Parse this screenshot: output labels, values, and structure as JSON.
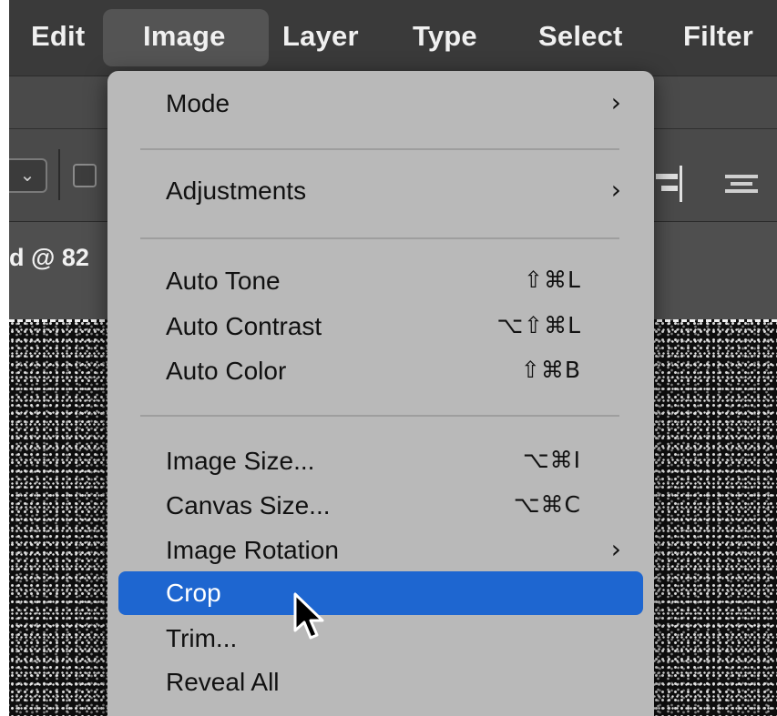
{
  "menubar": {
    "items": [
      "Edit",
      "Image",
      "Layer",
      "Type",
      "Select",
      "Filter"
    ],
    "active": "Image"
  },
  "document": {
    "tab_title_fragment": "d @ 82"
  },
  "image_menu": {
    "mode": {
      "label": "Mode",
      "submenu": true
    },
    "adjustments": {
      "label": "Adjustments",
      "submenu": true
    },
    "auto_tone": {
      "label": "Auto Tone",
      "shortcut": "⇧⌘L"
    },
    "auto_contrast": {
      "label": "Auto Contrast",
      "shortcut": "⌥⇧⌘L"
    },
    "auto_color": {
      "label": "Auto Color",
      "shortcut": "⇧⌘B"
    },
    "image_size": {
      "label": "Image Size...",
      "shortcut": "⌥⌘I"
    },
    "canvas_size": {
      "label": "Canvas Size...",
      "shortcut": "⌥⌘C"
    },
    "image_rotation": {
      "label": "Image Rotation",
      "submenu": true
    },
    "crop": {
      "label": "Crop",
      "selected": true
    },
    "trim": {
      "label": "Trim..."
    },
    "reveal_all": {
      "label": "Reveal All"
    },
    "submenu_glyph": "›"
  },
  "icons": {
    "dropdown": "chevron-down-icon",
    "checkbox": "checkbox-icon",
    "align_right": "align-right-icon",
    "align_center": "align-center-icon",
    "cursor": "arrow-cursor-icon"
  },
  "colors": {
    "menu_bg": "#b9b9b9",
    "selection": "#1e66d0",
    "menubar_bg": "#3a3a3a"
  }
}
